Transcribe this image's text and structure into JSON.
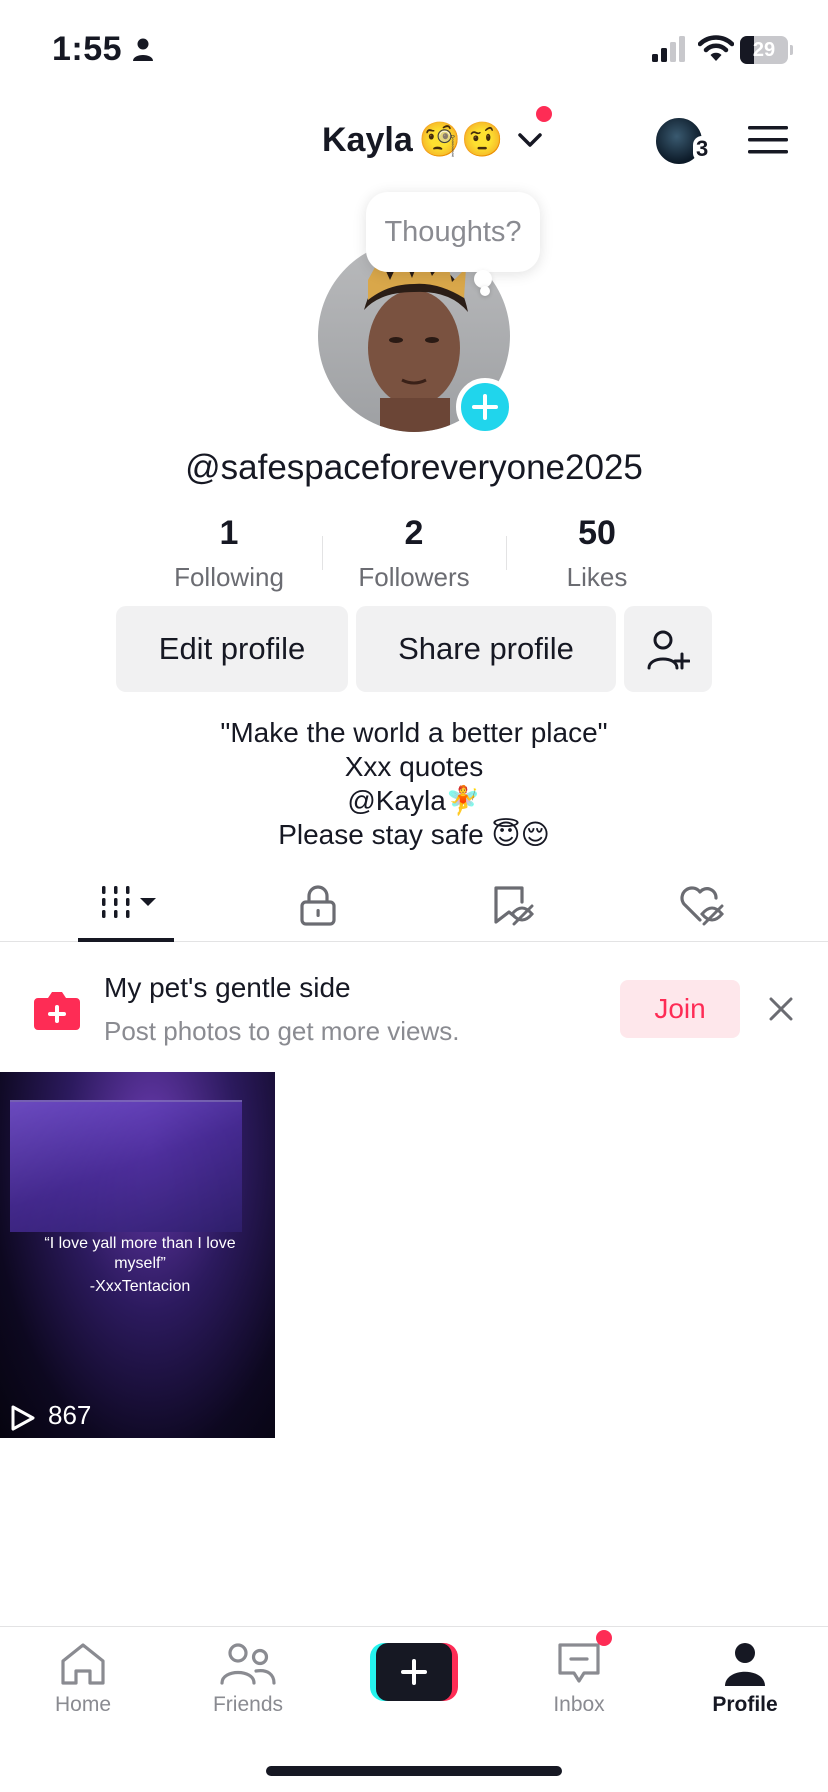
{
  "status_bar": {
    "time": "1:55",
    "battery": "29",
    "battery_level": 0.29
  },
  "header": {
    "account_name": "Kayla",
    "account_emojis": "🧐🤨",
    "friend_count": "3"
  },
  "profile": {
    "thought_bubble": "Thoughts?",
    "username": "@safespaceforeveryone2025",
    "stats": [
      {
        "value": "1",
        "label": "Following"
      },
      {
        "value": "2",
        "label": "Followers"
      },
      {
        "value": "50",
        "label": "Likes"
      }
    ],
    "buttons": {
      "edit": "Edit profile",
      "share": "Share profile"
    },
    "bio": [
      "\"Make the world a better place\"",
      "Xxx quotes",
      "@Kayla🧚",
      "Please stay safe 😇😌"
    ]
  },
  "tabs": [
    {
      "name": "videos",
      "icon": "grid-icon",
      "selected": true
    },
    {
      "name": "private",
      "icon": "lock-icon"
    },
    {
      "name": "favorites",
      "icon": "bookmark-hidden-icon"
    },
    {
      "name": "liked",
      "icon": "heart-hidden-icon"
    }
  ],
  "banner": {
    "title": "My pet's gentle side",
    "subtitle": "Post photos to get more views.",
    "join_label": "Join"
  },
  "videos": [
    {
      "caption": "“I love yall more than I love myself”",
      "credit": "-XxxTentacion",
      "views": "867"
    }
  ],
  "bottom_nav": [
    {
      "label": "Home",
      "icon": "home-icon"
    },
    {
      "label": "Friends",
      "icon": "friends-icon"
    },
    {
      "label": "",
      "icon": "create-plus-icon"
    },
    {
      "label": "Inbox",
      "icon": "inbox-icon"
    },
    {
      "label": "Profile",
      "icon": "profile-icon",
      "active": true
    }
  ],
  "colors": {
    "accent": "#fe2c55",
    "cyan": "#25f4ee",
    "text": "#161823",
    "muted": "#8a8b91"
  }
}
